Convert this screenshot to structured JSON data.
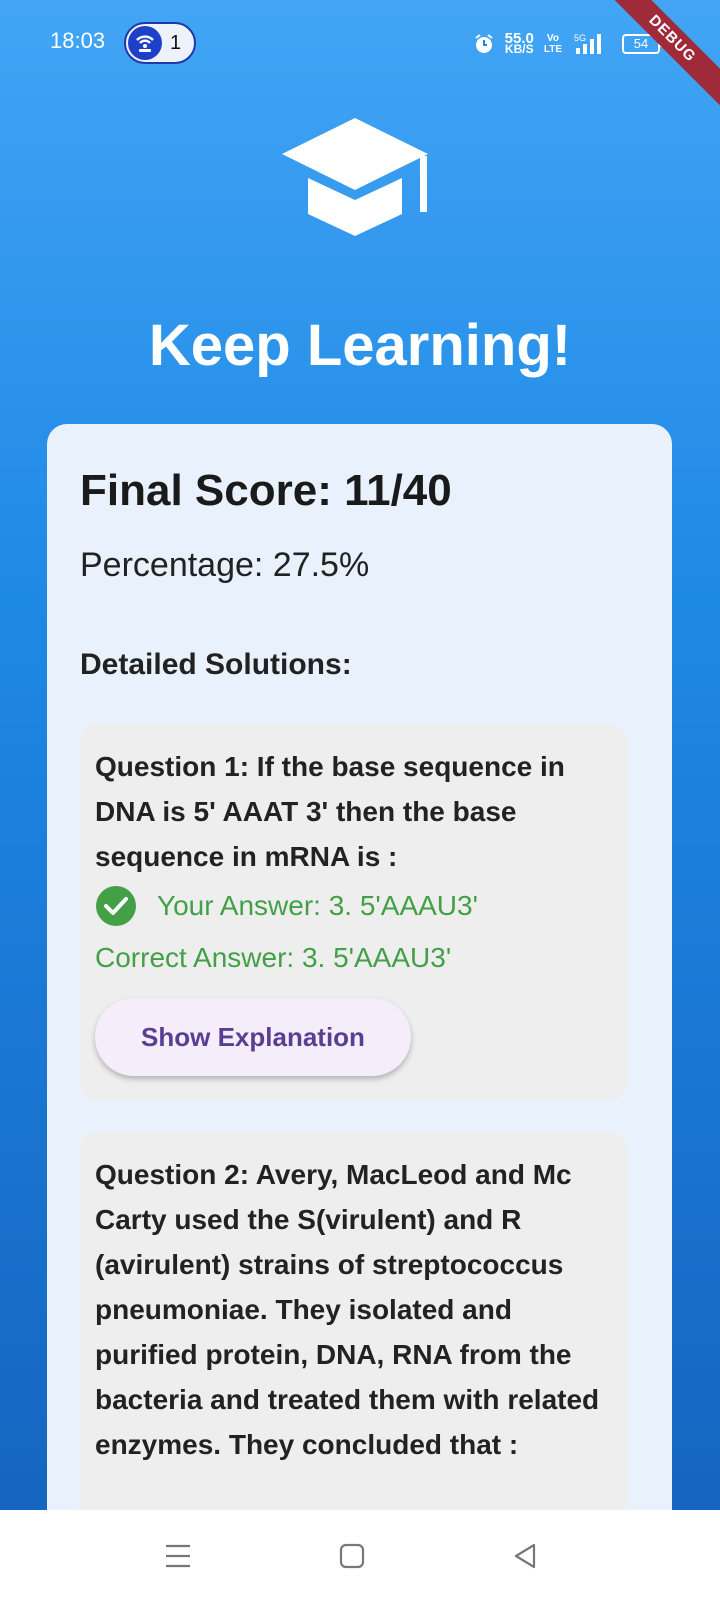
{
  "status_bar": {
    "time": "18:03",
    "hotspot_count": "1",
    "net_speed_value": "55.0",
    "net_speed_unit": "KB/S",
    "volte_top": "Vo",
    "volte_bottom": "LTE",
    "network_type": "5G",
    "battery": "54",
    "debug_label": "DEBUG"
  },
  "header": {
    "icon": "graduation-cap-icon",
    "title": "Keep Learning!"
  },
  "results": {
    "final_score": "Final Score: 11/40",
    "percentage": "Percentage: 27.5%",
    "solutions_heading": "Detailed Solutions:"
  },
  "questions": [
    {
      "text": "Question 1: If the base sequence in DNA is 5' AAAT 3' then the base sequence in mRNA is :",
      "your_answer": "Your Answer: 3. 5'AAAU3'",
      "correct_answer": "Correct Answer: 3. 5'AAAU3'",
      "explain_label": "Show Explanation"
    },
    {
      "text": "Question 2: Avery, MacLeod and Mc Carty used the S(virulent) and R (avirulent) strains of streptococcus pneumoniae. They isolated and purified protein, DNA, RNA from the bacteria and treated them with related enzymes. They concluded that :"
    }
  ],
  "colors": {
    "gradient_top": "#42a5f5",
    "gradient_bottom": "#1565c0",
    "correct_green": "#43a047",
    "button_text": "#5a3e94"
  },
  "nav_bar": {
    "icons": [
      "recent-apps-icon",
      "home-icon",
      "back-icon"
    ]
  }
}
